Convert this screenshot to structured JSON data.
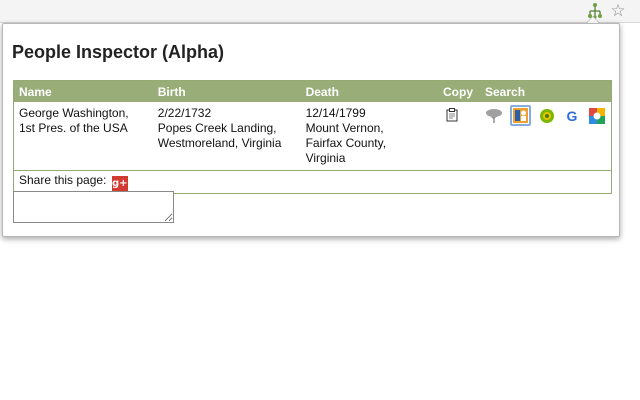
{
  "browser": {
    "extension_icon": "family-tree-icon",
    "bookmark_icon": "star-icon",
    "bookmark_glyph": "☆"
  },
  "popup": {
    "title": "People Inspector (Alpha)",
    "columns": {
      "name": "Name",
      "birth": "Birth",
      "death": "Death",
      "copy": "Copy",
      "search": "Search"
    },
    "person": {
      "name": [
        "George Washington,",
        "1st Pres. of the USA"
      ],
      "birth": [
        "2/22/1732",
        "Popes Creek Landing,",
        "Westmoreland, Virginia"
      ],
      "death": [
        "12/14/1799",
        "Mount Vernon,",
        "Fairfax County,",
        "Virginia"
      ]
    },
    "copy_icon": "clipboard-icon",
    "search_icons": [
      "family-tree-search-icon",
      "people-finder-search-icon",
      "green-circle-search-icon",
      "google-search-icon",
      "google-plus-search-icon"
    ],
    "share_label": "Share this page:",
    "share_icon": "google-plus-icon",
    "share_glyph": "g+",
    "google_glyph": "G",
    "note_value": ""
  },
  "colors": {
    "header_green": "#98ad78",
    "border_green": "#93aa73",
    "gplus_red": "#d23b2f"
  }
}
